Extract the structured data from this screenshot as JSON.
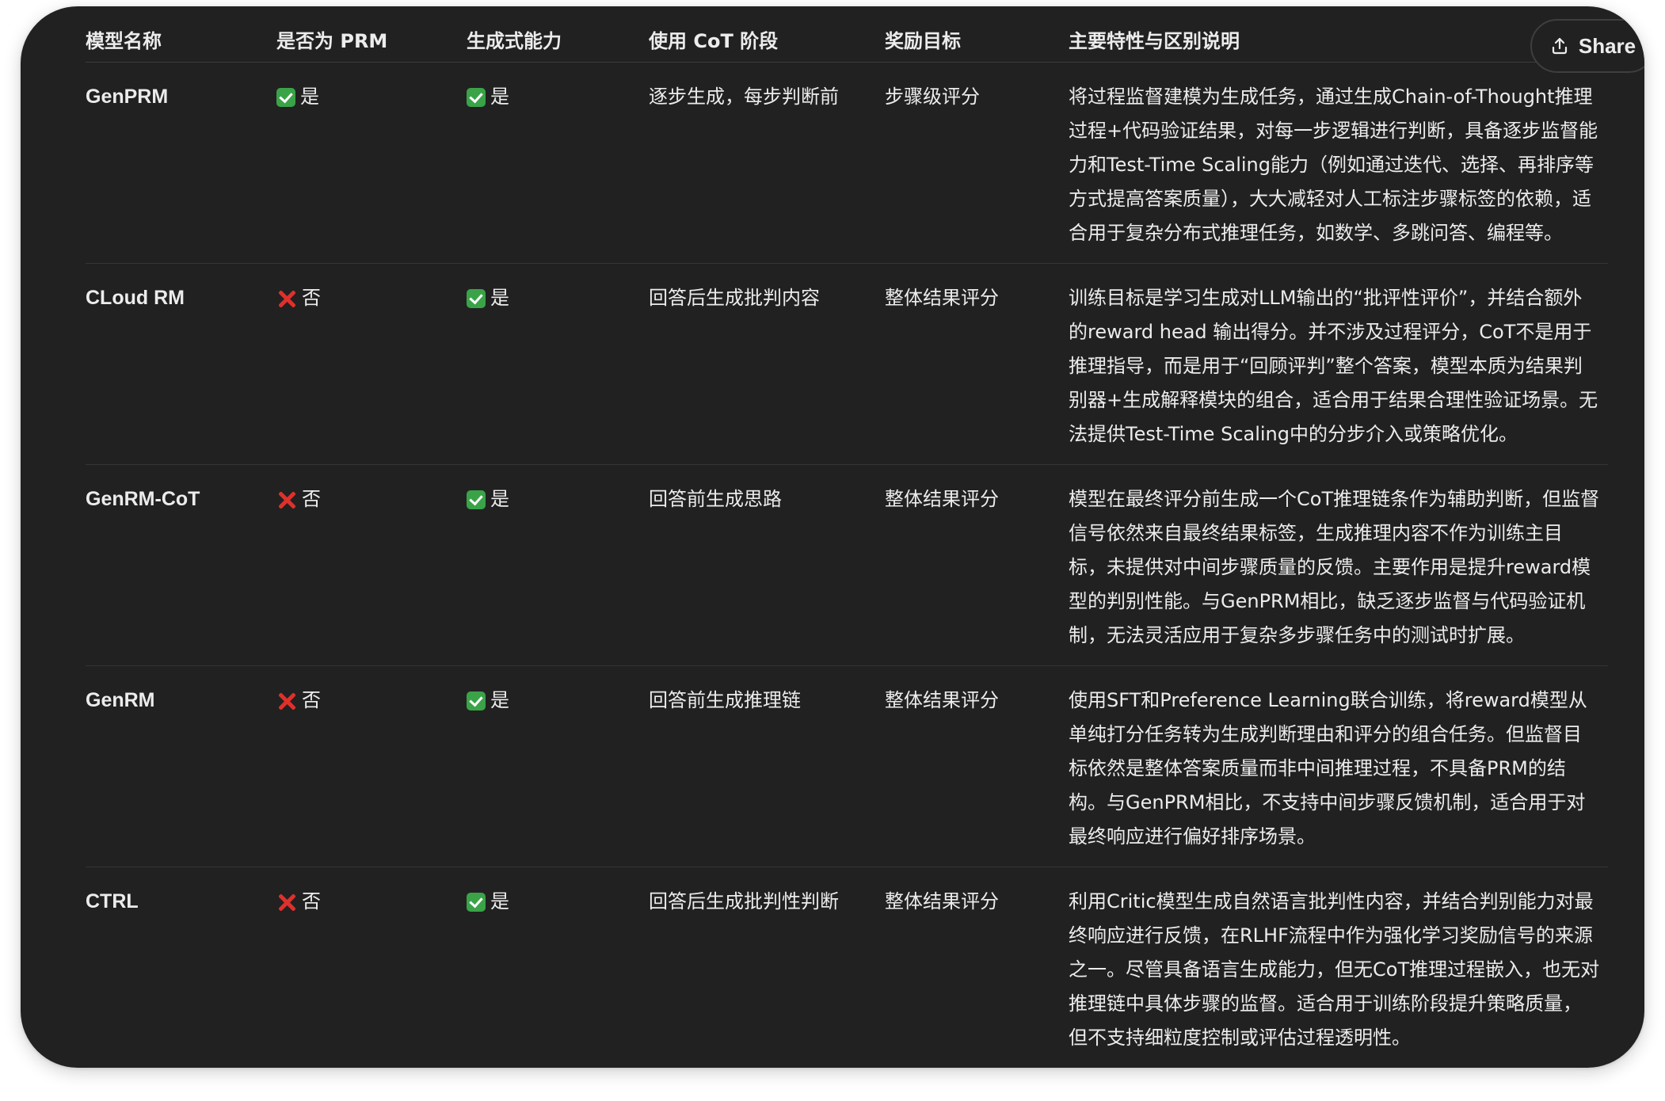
{
  "share_button": {
    "label": "Share",
    "icon": "upload-share-icon"
  },
  "table": {
    "headers": [
      "模型名称",
      "是否为 PRM",
      "生成式能力",
      "使用 CoT 阶段",
      "奖励目标",
      "主要特性与区别说明"
    ],
    "rows": [
      {
        "name": "GenPRM",
        "prm": {
          "icon": "check-icon",
          "text": "是"
        },
        "gen": {
          "icon": "check-icon",
          "text": "是"
        },
        "cot": "逐步生成，每步判断前",
        "reward": "步骤级评分",
        "desc": "将过程监督建模为生成任务，通过生成Chain-of-Thought推理过程+代码验证结果，对每一步逻辑进行判断，具备逐步监督能力和Test-Time Scaling能力（例如通过迭代、选择、再排序等方式提高答案质量），大大减轻对人工标注步骤标签的依赖，适合用于复杂分布式推理任务，如数学、多跳问答、编程等。"
      },
      {
        "name": "CLoud RM",
        "prm": {
          "icon": "cross-icon",
          "text": "否"
        },
        "gen": {
          "icon": "check-icon",
          "text": "是"
        },
        "cot": "回答后生成批判内容",
        "reward": "整体结果评分",
        "desc": "训练目标是学习生成对LLM输出的“批评性评价”，并结合额外的reward head 输出得分。并不涉及过程评分，CoT不是用于推理指导，而是用于“回顾评判”整个答案，模型本质为结果判别器+生成解释模块的组合，适合用于结果合理性验证场景。无法提供Test-Time Scaling中的分步介入或策略优化。"
      },
      {
        "name": "GenRM-CoT",
        "prm": {
          "icon": "cross-icon",
          "text": "否"
        },
        "gen": {
          "icon": "check-icon",
          "text": "是"
        },
        "cot": "回答前生成思路",
        "reward": "整体结果评分",
        "desc": "模型在最终评分前生成一个CoT推理链条作为辅助判断，但监督信号依然来自最终结果标签，生成推理内容不作为训练主目标，未提供对中间步骤质量的反馈。主要作用是提升reward模型的判别性能。与GenPRM相比，缺乏逐步监督与代码验证机制，无法灵活应用于复杂多步骤任务中的测试时扩展。"
      },
      {
        "name": "GenRM",
        "prm": {
          "icon": "cross-icon",
          "text": "否"
        },
        "gen": {
          "icon": "check-icon",
          "text": "是"
        },
        "cot": "回答前生成推理链",
        "reward": "整体结果评分",
        "desc": "使用SFT和Preference Learning联合训练，将reward模型从单纯打分任务转为生成判断理由和评分的组合任务。但监督目标依然是整体答案质量而非中间推理过程，不具备PRM的结构。与GenPRM相比，不支持中间步骤反馈机制，适合用于对最终响应进行偏好排序场景。"
      },
      {
        "name": "CTRL",
        "prm": {
          "icon": "cross-icon",
          "text": "否"
        },
        "gen": {
          "icon": "check-icon",
          "text": "是"
        },
        "cot": "回答后生成批判性判断",
        "reward": "整体结果评分",
        "desc": "利用Critic模型生成自然语言批判性内容，并结合判别能力对最终响应进行反馈，在RLHF流程中作为强化学习奖励信号的来源之一。尽管具备语言生成能力，但无CoT推理过程嵌入，也无对推理链中具体步骤的监督。适合用于训练阶段提升策略质量，但不支持细粒度控制或评估过程透明性。"
      }
    ]
  }
}
